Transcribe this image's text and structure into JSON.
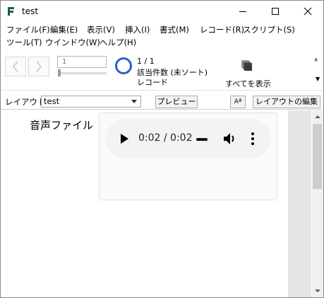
{
  "window": {
    "title": "test"
  },
  "menu": {
    "row1": [
      "ファイル(F)",
      "編集(E)",
      "表示(V)",
      "挿入(I)",
      "書式(M)",
      "レコード(R)",
      "スクリプト(S)"
    ],
    "row2": [
      "ツール(T)",
      "ウインドウ(W)",
      "ヘルプ(H)"
    ]
  },
  "toolbar": {
    "record_number": "1",
    "record_count": "1 / 1",
    "found_text": "該当件数 (未ソート)",
    "record_label": "レコード",
    "show_all_label": "すべてを表示",
    "scroll_up": "»",
    "scroll_down": "▼"
  },
  "layoutbar": {
    "label": "レイアウト:",
    "selected_layout": "test",
    "preview_button": "プレビュー",
    "aa_button": "Aª",
    "edit_layout_button": "レイアウトの編集"
  },
  "content": {
    "field_label": "音声ファイル",
    "audio": {
      "time": "0:02 / 0:02",
      "progress": 1.0
    }
  },
  "colors": {
    "accent": "#2a60c9",
    "player_bg": "#f1f3f4"
  }
}
